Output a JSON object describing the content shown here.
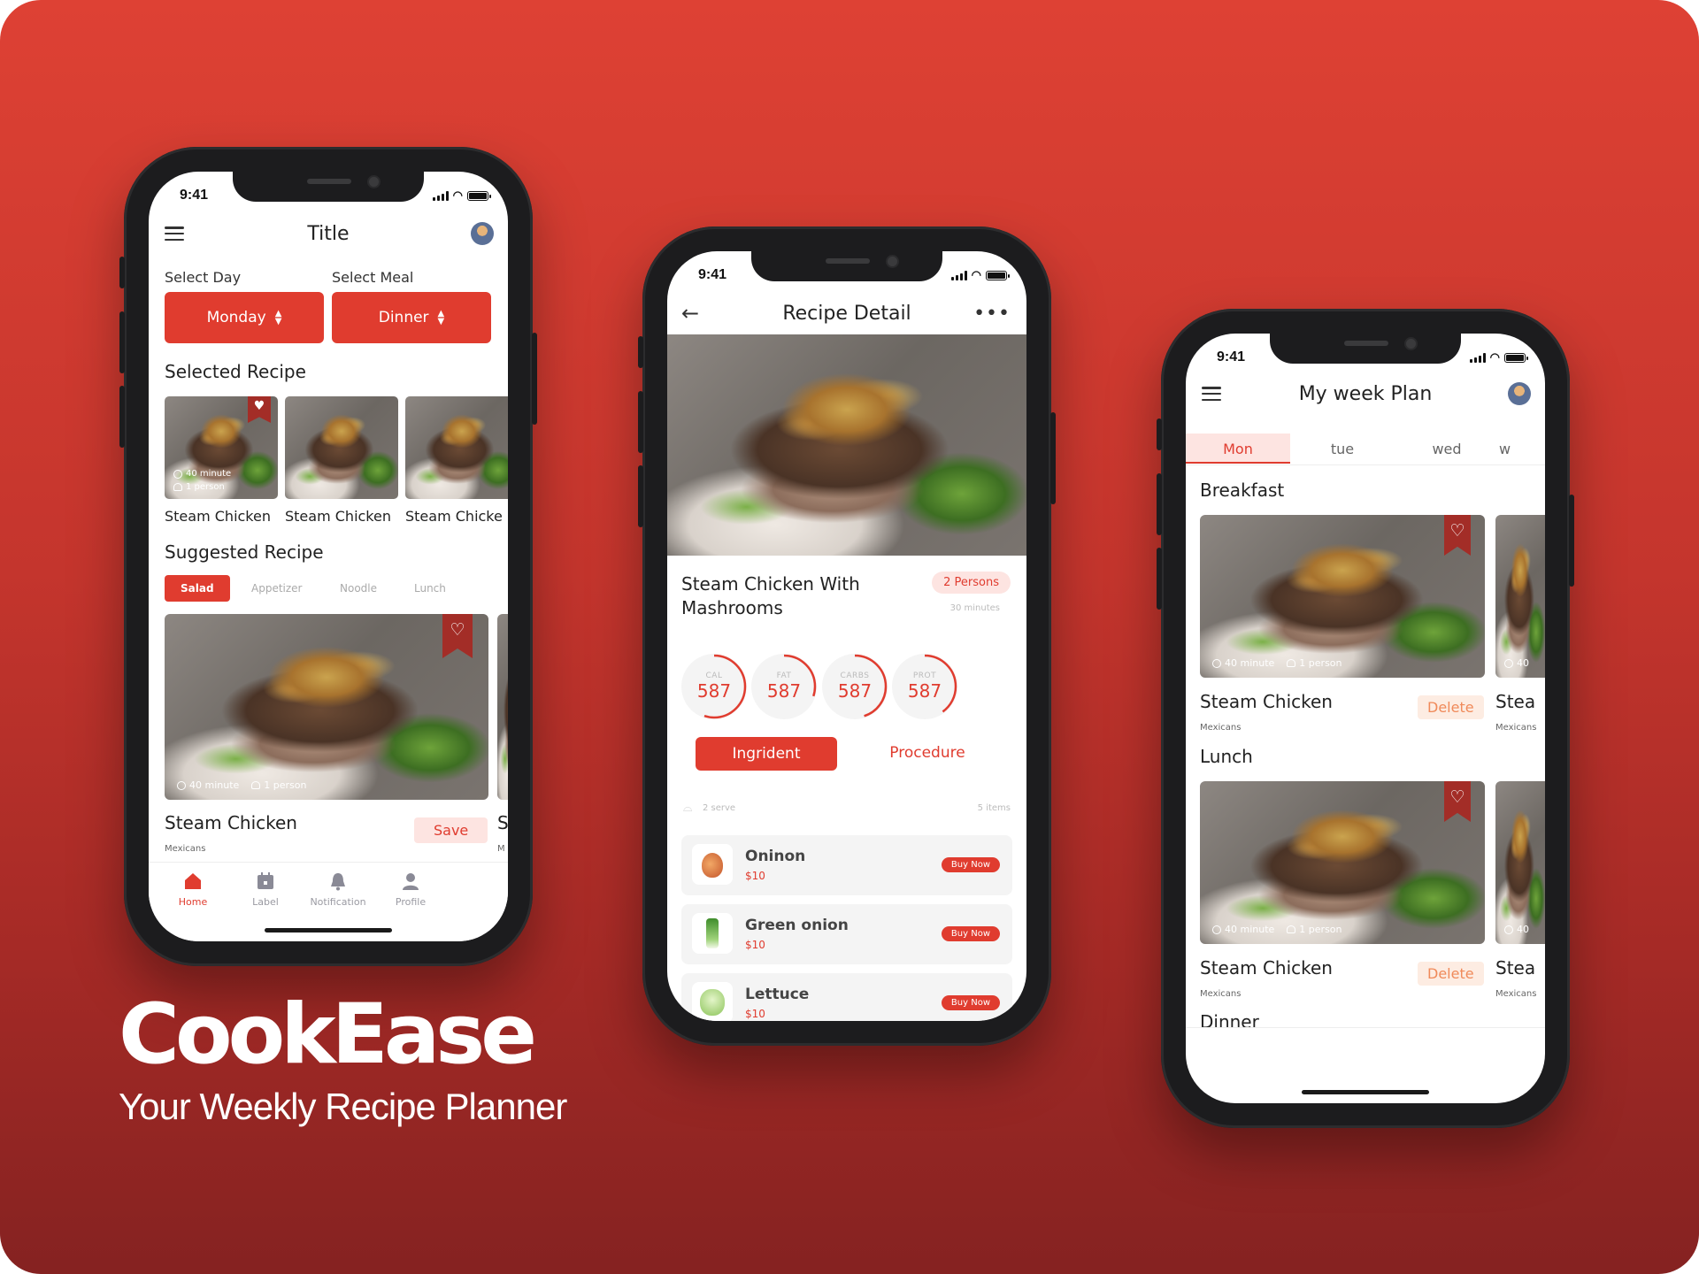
{
  "brand": {
    "name": "CookEase",
    "tagline": "Your Weekly Recipe Planner"
  },
  "status_time": "9:41",
  "phone1": {
    "title": "Title",
    "select_day_label": "Select Day",
    "select_meal_label": "Select Meal",
    "day_value": "Monday",
    "meal_value": "Dinner",
    "selected_heading": "Selected Recipe",
    "selected_items": [
      {
        "name": "Steam Chicken",
        "time": "40 minute",
        "people": "1 person"
      },
      {
        "name": "Steam Chicken"
      },
      {
        "name": "Steam Chicke"
      }
    ],
    "suggested_heading": "Suggested Recipe",
    "chips": [
      "Salad",
      "Appetizer",
      "Noodle",
      "Lunch"
    ],
    "card": {
      "name": "Steam Chicken",
      "cuisine": "Mexicans",
      "time": "40 minute",
      "people": "1 person",
      "save_label": "Save",
      "peek_name": "S",
      "peek_sub": "M"
    },
    "nav": [
      "Home",
      "Label",
      "Notification",
      "Profile"
    ]
  },
  "phone2": {
    "title": "Recipe Detail",
    "recipe_name_1": "Steam Chicken With",
    "recipe_name_2": "Mashrooms",
    "persons": "2 Persons",
    "duration": "30 minutes",
    "stats": [
      {
        "key": "CAL",
        "value": "587",
        "fill": 0.55
      },
      {
        "key": "FAT",
        "value": "587",
        "fill": 0.3
      },
      {
        "key": "CARBS",
        "value": "587",
        "fill": 0.45
      },
      {
        "key": "PROT",
        "value": "587",
        "fill": 0.4
      }
    ],
    "tab_active": "Ingrident",
    "tab_inactive": "Procedure",
    "serve": "2 serve",
    "items_count": "5 items",
    "ingredients": [
      {
        "name": "Oninon",
        "price": "$10",
        "buy": "Buy Now"
      },
      {
        "name": "Green onion",
        "price": "$10",
        "buy": "Buy Now"
      },
      {
        "name": "Lettuce",
        "price": "$10",
        "buy": "Buy Now"
      }
    ]
  },
  "phone3": {
    "title": "My week Plan",
    "days": [
      "Mon",
      "tue",
      "wed",
      "w"
    ],
    "breakfast_heading": "Breakfast",
    "lunch_heading": "Lunch",
    "dinner_heading": "Dinner",
    "card": {
      "name": "Steam Chicken",
      "cuisine": "Mexicans",
      "time": "40 minute",
      "people": "1 person",
      "delete_label": "Delete",
      "peek_name": "Stea",
      "peek_sub": "Mexicans",
      "peek_time": "40"
    }
  },
  "colors": {
    "accent": "#e03c2f",
    "background_top": "#de4134",
    "background_bottom": "#852221"
  }
}
